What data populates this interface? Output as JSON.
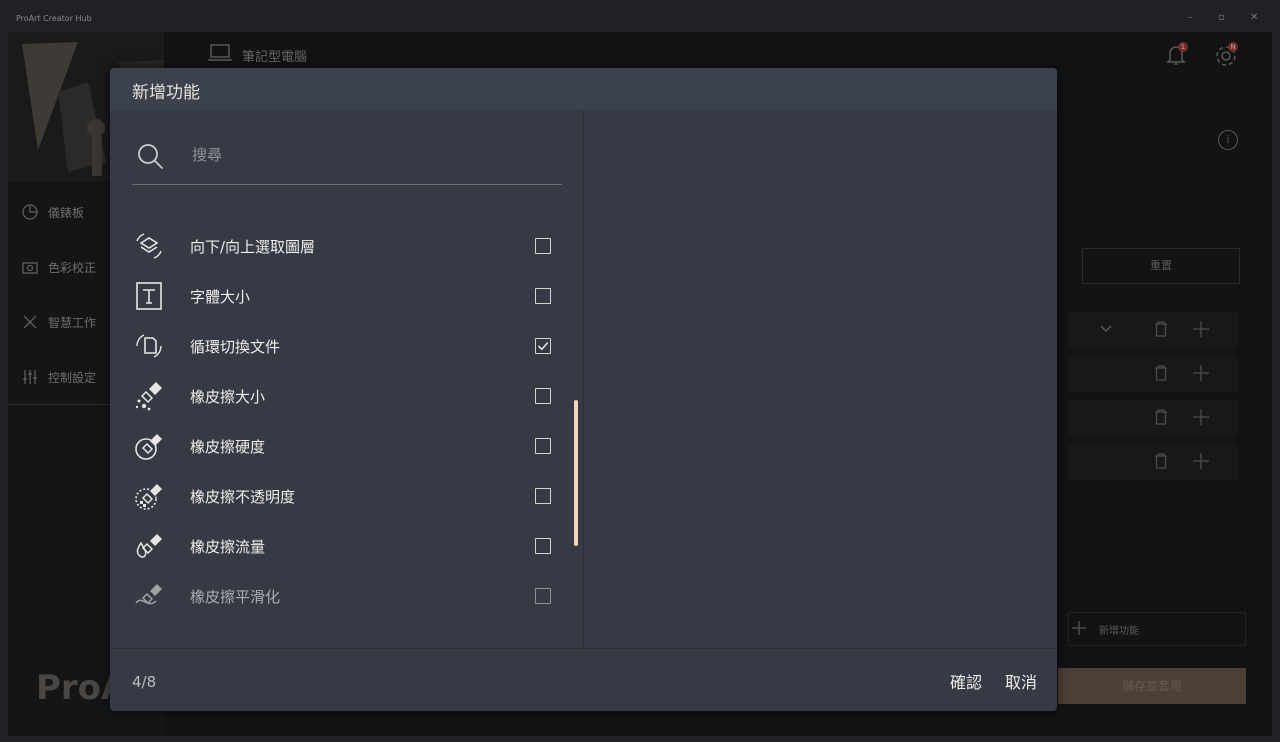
{
  "window": {
    "title": "ProArt Creator Hub",
    "minimize_glyph": "–",
    "maximize_glyph": "▫",
    "close_glyph": "✕"
  },
  "background_app": {
    "device_tab": "筆記型電腦",
    "notifications_badge": "1",
    "settings_badge": "N",
    "info_glyph": "i",
    "sidebar": {
      "items": [
        {
          "label": "儀錶板",
          "icon": "pie-chart-icon"
        },
        {
          "label": "色彩校正",
          "icon": "camera-icon"
        },
        {
          "label": "智慧工作",
          "icon": "tools-icon"
        },
        {
          "label": "控制設定",
          "icon": "sliders-icon"
        }
      ],
      "logo": "ProA"
    },
    "reset_button": "重置",
    "add_function_button": "新增功能",
    "save_apply_button": "儲存並套用"
  },
  "dialog": {
    "title": "新增功能",
    "search": {
      "placeholder": "搜尋",
      "value": ""
    },
    "items": [
      {
        "label": "向下/向上選取圖層",
        "icon": "layer-select-icon",
        "checked": false
      },
      {
        "label": "字體大小",
        "icon": "font-size-icon",
        "checked": false
      },
      {
        "label": "循環切換文件",
        "icon": "cycle-document-icon",
        "checked": true
      },
      {
        "label": "橡皮擦大小",
        "icon": "eraser-size-icon",
        "checked": false
      },
      {
        "label": "橡皮擦硬度",
        "icon": "eraser-hardness-icon",
        "checked": false
      },
      {
        "label": "橡皮擦不透明度",
        "icon": "eraser-opacity-icon",
        "checked": false
      },
      {
        "label": "橡皮擦流量",
        "icon": "eraser-flow-icon",
        "checked": false
      },
      {
        "label": "橡皮擦平滑化",
        "icon": "eraser-smoothing-icon",
        "checked": false
      }
    ],
    "count": "4/8",
    "confirm_label": "確認",
    "cancel_label": "取消",
    "accent_color": "#f3d5b8"
  }
}
